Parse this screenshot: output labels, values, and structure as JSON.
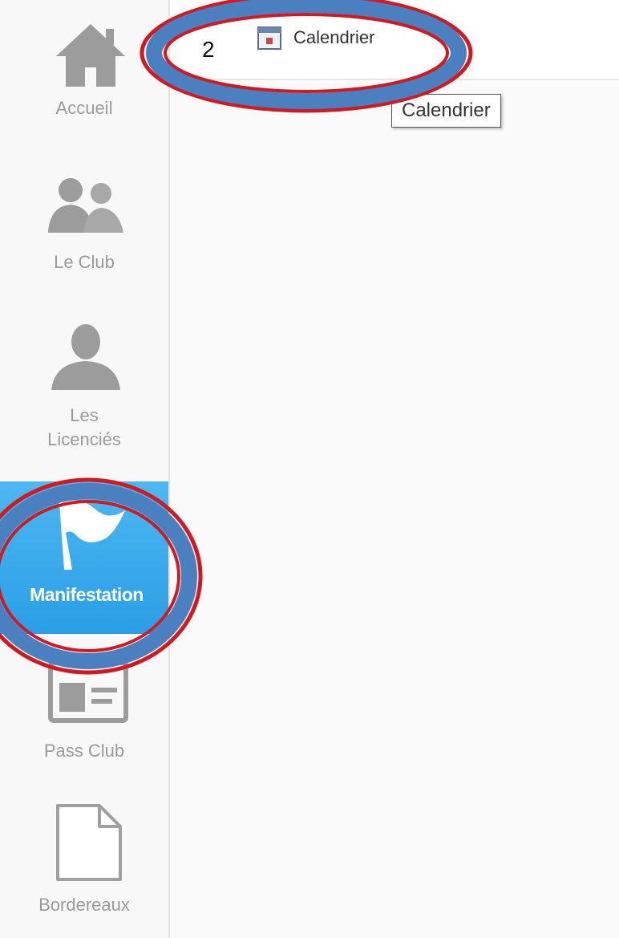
{
  "sidebar": {
    "items": [
      {
        "label": "Accueil",
        "icon": "home-icon"
      },
      {
        "label": "Le Club",
        "icon": "users-icon"
      },
      {
        "label": "Les Licenciés",
        "line1": "Les",
        "line2": "Licenciés",
        "icon": "user-icon"
      },
      {
        "label": "Manifestation",
        "icon": "flag-icon",
        "active": true
      },
      {
        "label": "Pass Club",
        "icon": "card-icon"
      },
      {
        "label": "Bordereaux",
        "icon": "document-icon"
      }
    ]
  },
  "topbar": {
    "tab_label": "Calendrier",
    "tab_icon": "calendar-icon"
  },
  "annotation": {
    "step_number": "2"
  },
  "tooltip": {
    "text": "Calendrier"
  },
  "colors": {
    "active_bg": "#2a9ee6",
    "annotation_ring": "#d31920",
    "annotation_fill": "#4a7fc0",
    "inactive_text": "#9a9a9a"
  }
}
